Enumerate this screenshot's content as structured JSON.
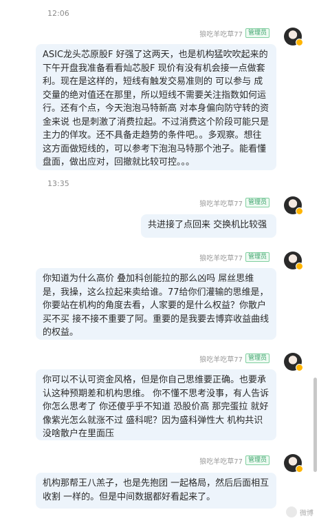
{
  "timestamps": [
    "12:06",
    "13:35"
  ],
  "sender_name": "狼吃羊吃草77",
  "badge": "管理员",
  "messages": [
    "ASIC龙头芯原股F 好强了这两天，也是机构猛吹吹起来的 下午开盘我准备看看灿芯股F 现价有没有机会接一点做套利。现在是这样的，短线有触发交易准则的 可以参与 成交量的绝对值还在那里，所以短线不需要关注指数如何运行。还有个点，今天泡泡马特新高 对本身偏向防守转的资金来说 也是刺激了消费拉起。不过消费这个阶段可能只是主力的佯攻。还不具备走趋势的条件吧。。多观察。想往这方面做短线的，可以参考下泡泡马特那个池子。能看懂盘面，做出应对，回撤就比较可控。。。",
    "共进接了点回来 交换机比较强",
    "你知道为什么高价 叠加科创能拉的那么凶吗 屌丝思维是，我操，这么拉起来卖给谁。77给你们灌输的思维是，你要站在机构的角度去看，人家要的是什么权益？你散户买不买 接不接不重要了阿。重要的是我要去博弈收益曲线的权益。",
    "你可以不认可资金风格，但是你自己思维要正确。也要承认这种预期差和机构思维。 你不懂不思考没事，有人告诉你怎么思考了 你还傻乎乎不知道 恐股价高 那完蛋拉 就好像紫光怎么就涨不过 盛科呢？因为盛科弹性大 机构共识 没啥散户在里面压",
    "机构那帮王八羔子，也是先抱团 一起格局，然后后面相互收割 一样的。但是中间数据都好看起来了。"
  ],
  "watermark_text": "微博"
}
